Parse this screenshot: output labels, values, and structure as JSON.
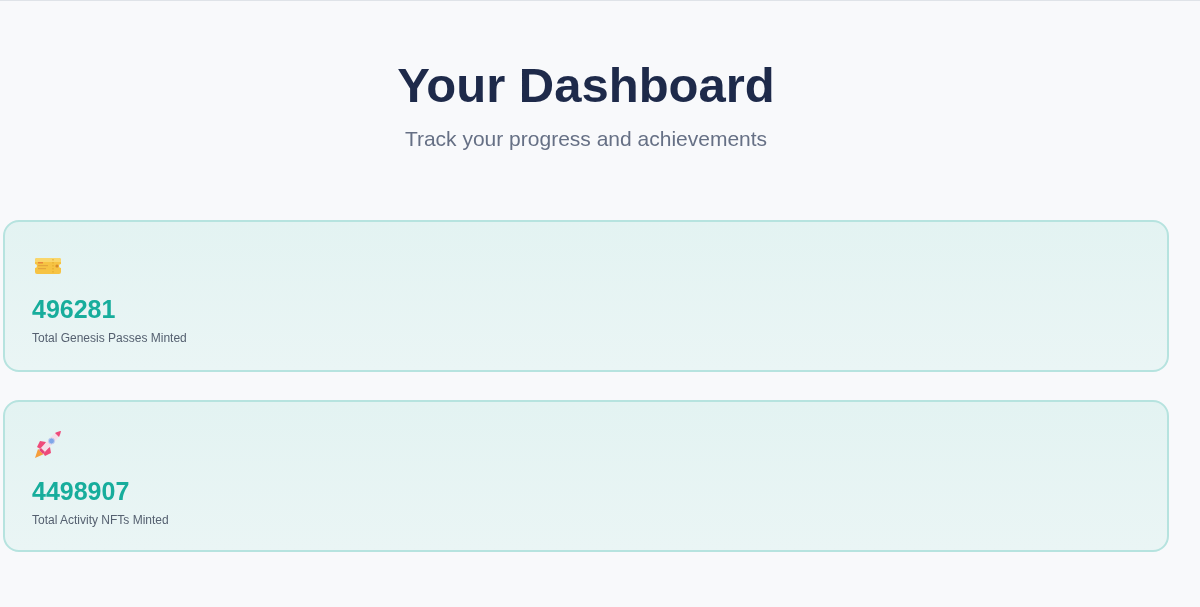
{
  "header": {
    "title": "Your Dashboard",
    "subtitle": "Track your progress and achievements"
  },
  "stats": [
    {
      "kind": "ticket",
      "value": "496281",
      "label": "Total Genesis Passes Minted"
    },
    {
      "kind": "rocket",
      "value": "4498907",
      "label": "Total Activity NFTs Minted"
    }
  ]
}
